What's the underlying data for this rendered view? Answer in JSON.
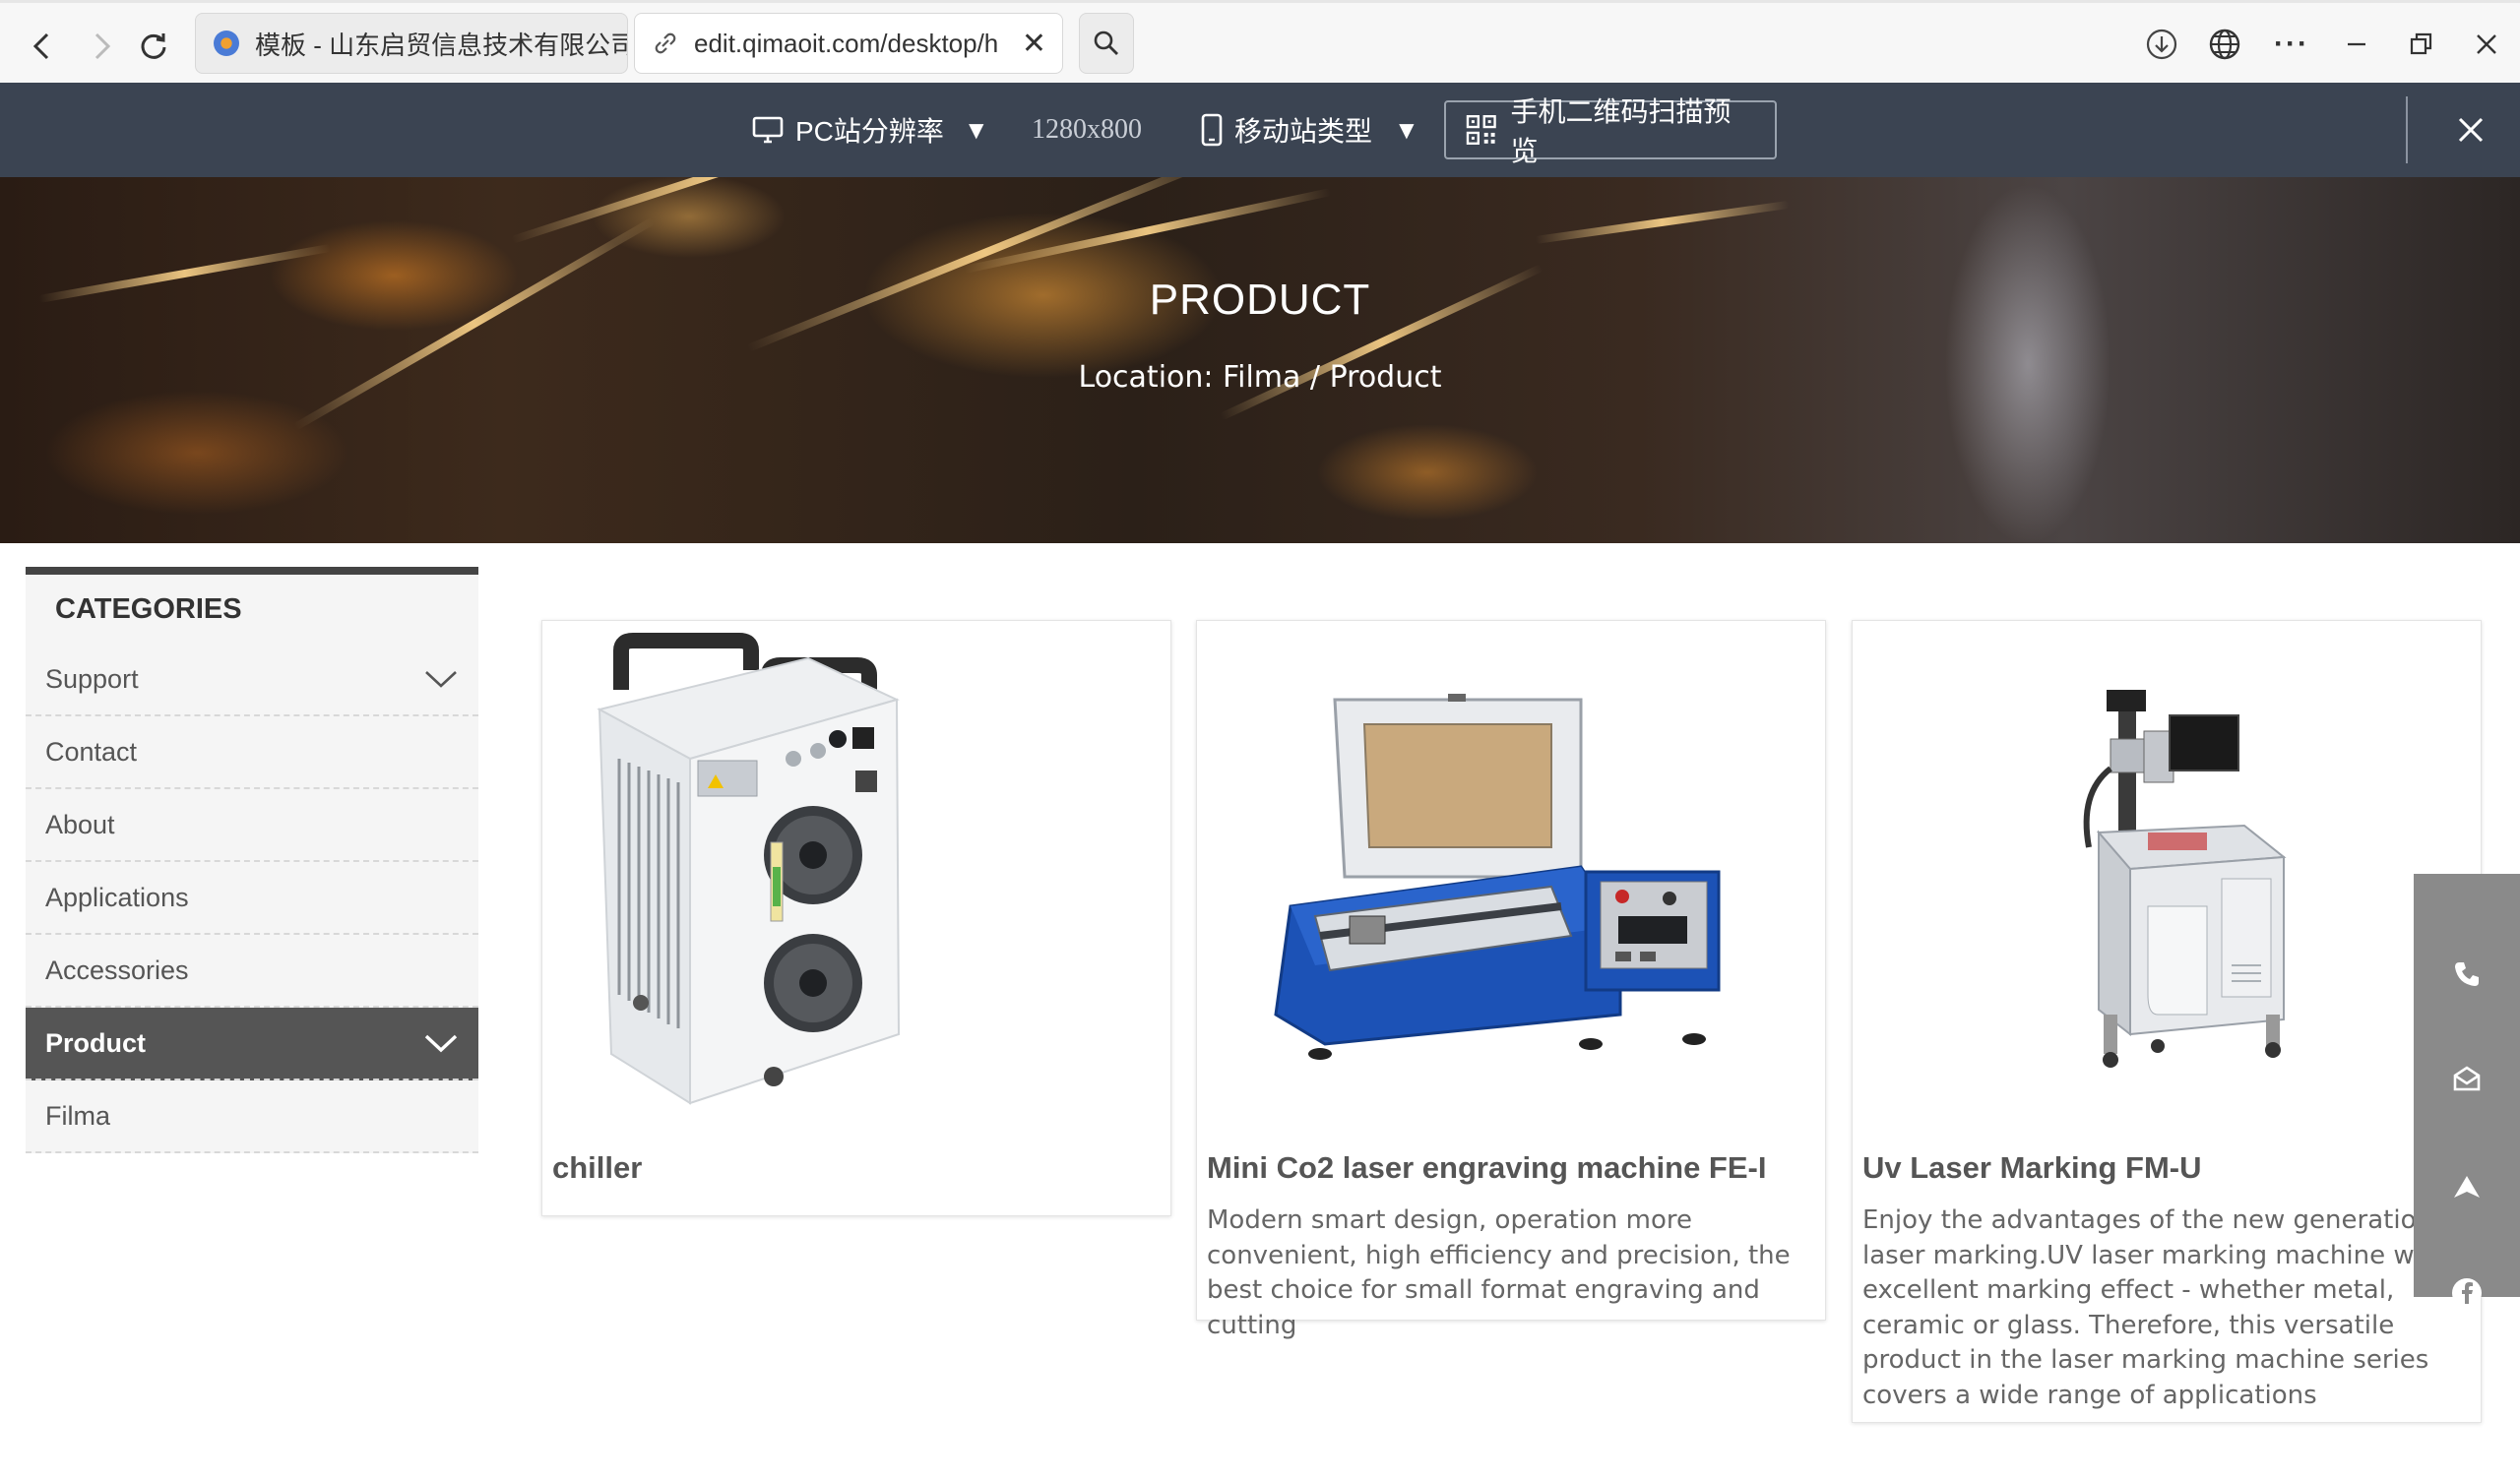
{
  "browser": {
    "tabs": [
      {
        "title": "模板 - 山东启贸信息技术有限公司",
        "active": false
      },
      {
        "title": "edit.qimaoit.com/desktop/h",
        "active": true
      }
    ],
    "icons": [
      "back-icon",
      "forward-icon",
      "reload-icon",
      "search-icon",
      "download-icon",
      "globe-icon",
      "more-icon",
      "minimize-icon",
      "restore-icon",
      "close-icon"
    ]
  },
  "toolbar": {
    "pc_label": "PC站分辨率",
    "resolution": "1280x800",
    "mobile_label": "移动站类型",
    "qr_label": "手机二维码扫描预览",
    "caret": "▼",
    "colors": {
      "background": "#3b4452"
    }
  },
  "banner": {
    "title": "PRODUCT",
    "location": "Location: Filma / Product"
  },
  "sidebar": {
    "heading": "CATEGORIES",
    "items": [
      {
        "label": "Support",
        "expandable": true,
        "active": false
      },
      {
        "label": "Contact",
        "expandable": false,
        "active": false
      },
      {
        "label": "About",
        "expandable": false,
        "active": false
      },
      {
        "label": "Applications",
        "expandable": false,
        "active": false
      },
      {
        "label": "Accessories",
        "expandable": false,
        "active": false
      },
      {
        "label": "Product",
        "expandable": true,
        "active": true
      },
      {
        "label": "Filma",
        "expandable": false,
        "active": false
      }
    ]
  },
  "products": [
    {
      "title": "chiller",
      "description": ""
    },
    {
      "title": "Mini Co2 laser engraving machine FE-I",
      "description": "Modern smart design, operation more convenient, high efficiency and precision, the best choice for small format engraving and cutting"
    },
    {
      "title": "Uv Laser Marking FM-U",
      "description": "Enjoy the advantages of the new generation of laser marking.UV laser marking machine with excellent marking effect - whether metal, ceramic or glass. Therefore, this versatile product in the laser marking machine series covers a wide range of applications"
    }
  ],
  "float_bar": {
    "icons": [
      "phone-icon",
      "email-icon",
      "back-to-top-icon",
      "facebook-icon"
    ]
  }
}
